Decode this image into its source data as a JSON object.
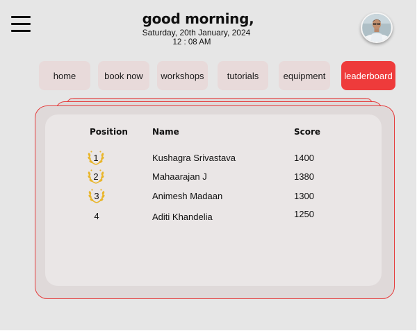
{
  "header": {
    "greeting": "good morning,",
    "date": "Saturday, 20th January, 2024",
    "time": "12 : 08 AM"
  },
  "icons": {
    "menu": "hamburger-menu-icon",
    "avatar": "user-avatar-photo",
    "medal": "laurel-wreath-icon"
  },
  "nav": {
    "items": [
      {
        "label": "home"
      },
      {
        "label": "book now"
      },
      {
        "label": "workshops"
      },
      {
        "label": "tutorials"
      },
      {
        "label": "equipment"
      },
      {
        "label": "leaderboard",
        "active": true
      }
    ]
  },
  "leaderboard": {
    "columns": {
      "position": "Position",
      "name": "Name",
      "score": "Score"
    },
    "rows": [
      {
        "position": "1",
        "name": "Kushagra Srivastava",
        "score": "1400",
        "medal": true
      },
      {
        "position": "2",
        "name": "Mahaarajan J",
        "score": "1380",
        "medal": true
      },
      {
        "position": "3",
        "name": "Animesh Madaan",
        "score": "1300",
        "medal": true
      },
      {
        "position": "4",
        "name": "Aditi Khandelia",
        "score": "1250",
        "medal": false
      }
    ]
  },
  "colors": {
    "background": "#e6e6e6",
    "nav_button": "#e8dada",
    "accent": "#ee3b3b",
    "card_border": "#e53b3b",
    "card_fill": "#dfd9d9",
    "card_inner": "#eae6e6",
    "medal_gold": "#e9b62c"
  }
}
